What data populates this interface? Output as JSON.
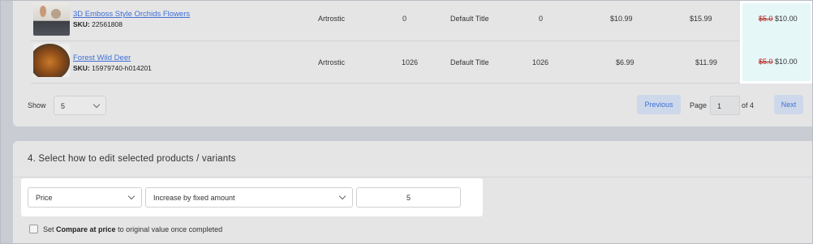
{
  "products": [
    {
      "title": "3D Emboss Style Orchids Flowers",
      "sku_label": "SKU:",
      "sku": "22561808",
      "vendor": "Artrostic",
      "quantity": "0",
      "variant": "Default Title",
      "variant_quantity": "0",
      "cost": "$10.99",
      "price": "$15.99",
      "new_old": "$5.0",
      "new_value": "$10.00"
    },
    {
      "title": "Forest Wild Deer",
      "sku_label": "SKU:",
      "sku": "15979740-h014201",
      "vendor": "Artrostic",
      "quantity": "1026",
      "variant": "Default Title",
      "variant_quantity": "1026",
      "cost": "$6.99",
      "price": "$11.99",
      "new_old": "$5.0",
      "new_value": "$10.00"
    }
  ],
  "pagination": {
    "show_label": "Show",
    "show_value": "5",
    "previous_label": "Previous",
    "page_label": "Page",
    "page_value": "1",
    "of_label": "of 4",
    "next_label": "Next"
  },
  "edit_section": {
    "title": "4. Select how to edit selected products / variants",
    "field_select": "Price",
    "method_select": "Increase by fixed amount",
    "amount_value": "5",
    "checkbox_prefix": "Set",
    "checkbox_bold": "Compare at price",
    "checkbox_suffix": "to original value once completed",
    "checkbox_checked": false
  },
  "colors": {
    "link": "#3f6fd6",
    "strike_price": "#b3261e",
    "highlight": "#e6f7f8",
    "button_bg": "#cdd9ea"
  }
}
